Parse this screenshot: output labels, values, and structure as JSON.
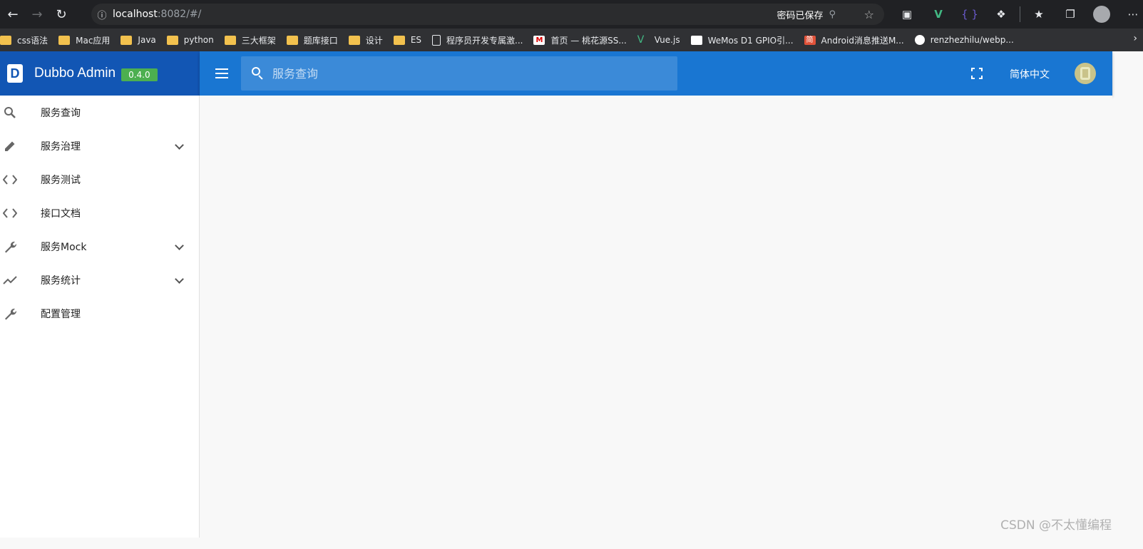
{
  "browser": {
    "url_host": "localhost",
    "url_path": ":8082/#/",
    "password_saved": "密码已保存",
    "bookmarks": [
      "css语法",
      "Mac应用",
      "Java",
      "python",
      "三大框架",
      "题库接口",
      "设计",
      "ES",
      "程序员开发专属激...",
      "首页 — 桃花源SS...",
      "Vue.js",
      "WeMos D1 GPIO引...",
      "Android消息推送M...",
      "renzhezhilu/webp..."
    ]
  },
  "app": {
    "title": "Dubbo Admin",
    "version": "0.4.0",
    "logo_letter": "D"
  },
  "toolbar": {
    "search_placeholder": "服务查询",
    "language": "简体中文"
  },
  "sidebar": {
    "items": [
      {
        "label": "服务查询",
        "icon": "search-icon",
        "expandable": false
      },
      {
        "label": "服务治理",
        "icon": "pencil-icon",
        "expandable": true
      },
      {
        "label": "服务测试",
        "icon": "code-icon",
        "expandable": false
      },
      {
        "label": "接口文档",
        "icon": "code-icon",
        "expandable": false
      },
      {
        "label": "服务Mock",
        "icon": "wrench-icon",
        "expandable": true
      },
      {
        "label": "服务统计",
        "icon": "trending-icon",
        "expandable": true
      },
      {
        "label": "配置管理",
        "icon": "wrench-icon",
        "expandable": false
      }
    ]
  },
  "watermark": "CSDN @不太懂编程"
}
